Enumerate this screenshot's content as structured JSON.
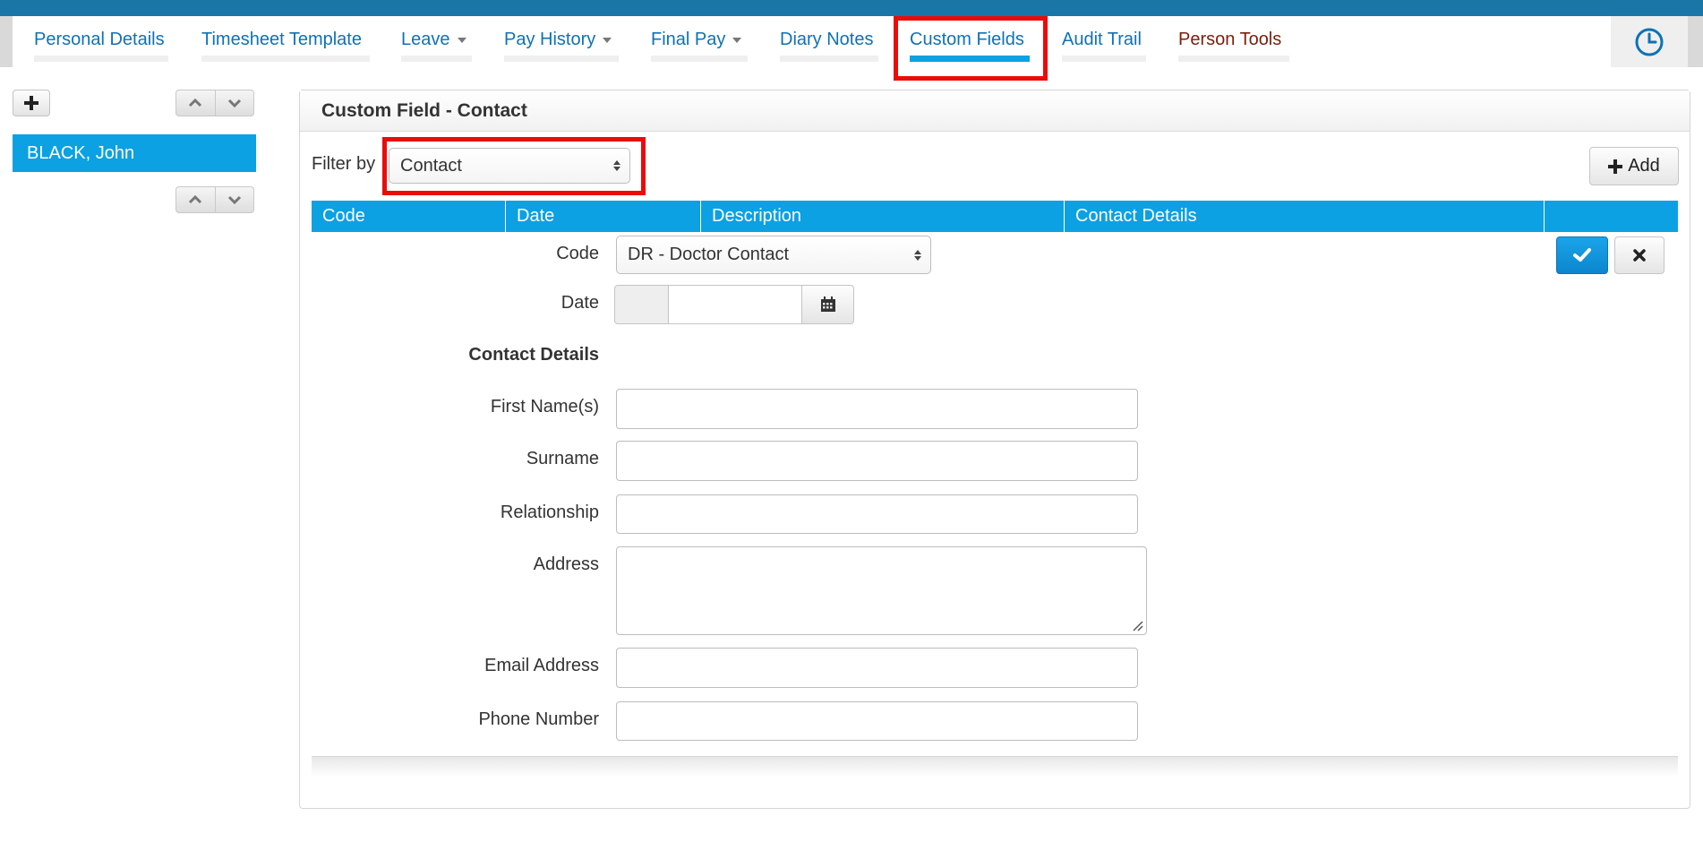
{
  "nav": {
    "tabs": [
      {
        "label": "Personal Details"
      },
      {
        "label": "Timesheet Template"
      },
      {
        "label": "Leave"
      },
      {
        "label": "Pay History"
      },
      {
        "label": "Final Pay"
      },
      {
        "label": "Diary Notes"
      },
      {
        "label": "Custom Fields"
      },
      {
        "label": "Audit Trail"
      },
      {
        "label": "Person Tools"
      }
    ],
    "active_tab": "Custom Fields",
    "clock_icon": "clock-icon"
  },
  "sidebar": {
    "add_icon": "plus-icon",
    "people": [
      {
        "name": "BLACK, John"
      }
    ]
  },
  "panel": {
    "title": "Custom Field - Contact",
    "filter_label": "Filter by",
    "filter_value": "Contact",
    "add_label": "Add",
    "columns": [
      "Code",
      "Date",
      "Description",
      "Contact Details"
    ]
  },
  "form": {
    "code_label": "Code",
    "code_value": "DR - Doctor Contact",
    "date_label": "Date",
    "date_value": "",
    "section_label": "Contact Details",
    "fields": [
      {
        "label": "First Name(s)",
        "value": ""
      },
      {
        "label": "Surname",
        "value": ""
      },
      {
        "label": "Relationship",
        "value": ""
      },
      {
        "label": "Address",
        "value": ""
      },
      {
        "label": "Email Address",
        "value": ""
      },
      {
        "label": "Phone Number",
        "value": ""
      }
    ]
  },
  "colors": {
    "accent": "#0ba1e3",
    "highlight": "#ea0b0b",
    "link": "#0e72b5",
    "tools_link": "#7a1f0a"
  }
}
